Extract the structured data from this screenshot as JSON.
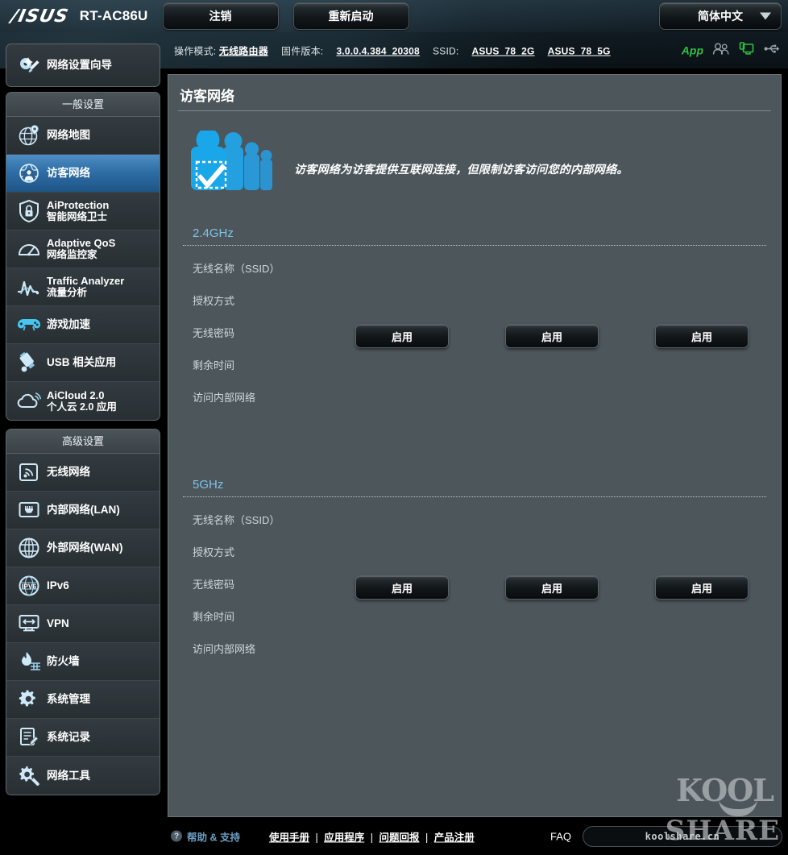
{
  "topbar": {
    "brand": "/ISUS",
    "model": "RT-AC86U",
    "logout_label": "注销",
    "reboot_label": "重新启动",
    "language": "简体中文"
  },
  "infobar": {
    "operation_mode_label": "操作模式:",
    "operation_mode_value": "无线路由器",
    "firmware_label": "固件版本:",
    "firmware_value": "3.0.0.4.384_20308",
    "ssid_label": "SSID:",
    "ssid_2g": "ASUS_78_2G",
    "ssid_5g": "ASUS_78_5G",
    "app_label": "App",
    "icons": [
      "app-label",
      "clients-icon",
      "network-monitor-icon",
      "usb-icon"
    ]
  },
  "sidebar": {
    "wizard": {
      "label": "网络设置向导",
      "icon": "wizard-icon"
    },
    "general_header": "一般设置",
    "general_items": [
      {
        "label": "网络地图",
        "sub": "",
        "icon": "network-map-icon",
        "active": false
      },
      {
        "label": "访客网络",
        "sub": "",
        "icon": "guest-network-icon",
        "active": true
      },
      {
        "label": "AiProtection",
        "sub": "智能网络卫士",
        "icon": "shield-lock-icon",
        "active": false
      },
      {
        "label": "Adaptive QoS",
        "sub": "网络监控家",
        "icon": "gauge-icon",
        "active": false
      },
      {
        "label": "Traffic Analyzer",
        "sub": "流量分析",
        "icon": "traffic-wave-icon",
        "active": false
      },
      {
        "label": "游戏加速",
        "sub": "",
        "icon": "gamepad-icon",
        "active": false
      },
      {
        "label": "USB 相关应用",
        "sub": "",
        "icon": "usb-drive-icon",
        "active": false
      },
      {
        "label": "AiCloud 2.0",
        "sub": "个人云 2.0 应用",
        "icon": "cloud-icon",
        "active": false
      }
    ],
    "advanced_header": "高级设置",
    "advanced_items": [
      {
        "label": "无线网络",
        "icon": "wireless-icon"
      },
      {
        "label": "内部网络(LAN)",
        "icon": "lan-port-icon"
      },
      {
        "label": "外部网络(WAN)",
        "icon": "globe-icon"
      },
      {
        "label": "IPv6",
        "icon": "ipv6-globe-icon"
      },
      {
        "label": "VPN",
        "icon": "vpn-monitor-icon"
      },
      {
        "label": "防火墙",
        "icon": "firewall-flame-icon"
      },
      {
        "label": "系统管理",
        "icon": "system-gear-icon"
      },
      {
        "label": "系统记录",
        "icon": "system-log-icon"
      },
      {
        "label": "网络工具",
        "icon": "network-tools-icon"
      }
    ]
  },
  "main": {
    "page_title": "访客网络",
    "banner_icon": "guest-people-check-icon",
    "description": "访客网络为访客提供互联网连接，但限制访客访问您的内部网络。",
    "bands": [
      {
        "title": "2.4GHz",
        "fields": [
          "无线名称（SSID）",
          "授权方式",
          "无线密码",
          "剩余时间",
          "访问内部网络"
        ],
        "buttons": [
          "启用",
          "启用",
          "启用"
        ]
      },
      {
        "title": "5GHz",
        "fields": [
          "无线名称（SSID）",
          "授权方式",
          "无线密码",
          "剩余时间",
          "访问内部网络"
        ],
        "buttons": [
          "启用",
          "启用",
          "启用"
        ]
      }
    ]
  },
  "watermark": {
    "line1": "KOOL",
    "line2": "SHARE"
  },
  "footer": {
    "help_support": "帮助 & 支持",
    "links": [
      "使用手册",
      "应用程序",
      "问题回报",
      "产品注册"
    ],
    "separator": "|",
    "faq": "FAQ",
    "search_value": "koolshare.cn"
  },
  "colors": {
    "accent_blue": "#7fc2e8",
    "active_item": "#2f6ea6",
    "panel_bg": "#4c565b",
    "green_status": "#2fbf3f",
    "help_link": "#6d9fc4"
  }
}
